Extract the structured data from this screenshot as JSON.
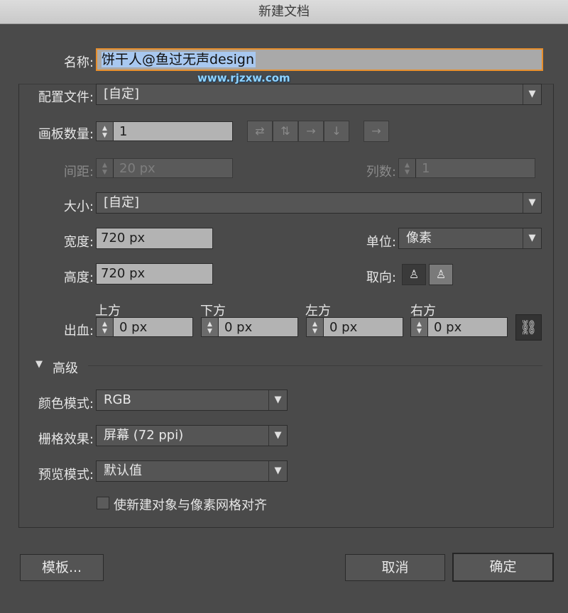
{
  "window": {
    "title": "新建文档"
  },
  "name": {
    "label": "名称:",
    "value": "饼干人@鱼过无声design"
  },
  "watermark": "www.rjzxw.com",
  "profile": {
    "label": "配置文件:",
    "value": "[自定]"
  },
  "artboards": {
    "label": "画板数量:",
    "value": "1"
  },
  "spacing": {
    "label": "间距:",
    "value": "20 px"
  },
  "columns": {
    "label": "列数:",
    "value": "1"
  },
  "size": {
    "label": "大小:",
    "value": "[自定]"
  },
  "width": {
    "label": "宽度:",
    "value": "720 px"
  },
  "height": {
    "label": "高度:",
    "value": "720 px"
  },
  "units": {
    "label": "单位:",
    "value": "像素"
  },
  "orientation": {
    "label": "取向:"
  },
  "bleed": {
    "label": "出血:",
    "top": {
      "label": "上方",
      "value": "0 px"
    },
    "bottom": {
      "label": "下方",
      "value": "0 px"
    },
    "left": {
      "label": "左方",
      "value": "0 px"
    },
    "right": {
      "label": "右方",
      "value": "0 px"
    }
  },
  "advanced": {
    "label": "高级",
    "color_mode": {
      "label": "颜色模式:",
      "value": "RGB"
    },
    "raster": {
      "label": "栅格效果:",
      "value": "屏幕 (72 ppi)"
    },
    "preview": {
      "label": "预览模式:",
      "value": "默认值"
    },
    "align_pixel": {
      "label": "使新建对象与像素网格对齐",
      "checked": false
    }
  },
  "buttons": {
    "templates": "模板...",
    "cancel": "取消",
    "ok": "确定"
  }
}
